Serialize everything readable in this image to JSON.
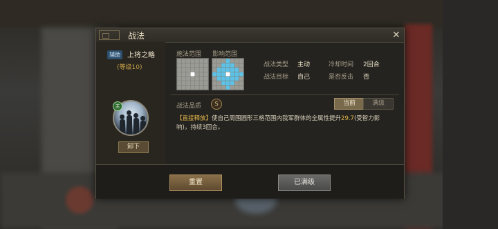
{
  "dialog": {
    "title": "战法",
    "close_icon": "close-icon"
  },
  "skill": {
    "tag": "辅助",
    "name": "上将之略",
    "level": "(等级10)",
    "unequip_label": "卸下",
    "avatar_badge": "主"
  },
  "ranges": {
    "cast_label": "施法范围",
    "effect_label": "影响范围",
    "grid_colors": {
      "cell": "#9b9b95",
      "line": "#7c7c77",
      "center": "#ffffff",
      "effect": "#5ec2e6"
    }
  },
  "info": {
    "type_label": "战法类型",
    "type_value": "主动",
    "target_label": "战法目标",
    "target_value": "自己",
    "cooldown_label": "冷却时间",
    "cooldown_value": "2回合",
    "counter_label": "是否反击",
    "counter_value": "否"
  },
  "quality": {
    "label": "战法品质",
    "value": "S"
  },
  "tabs": {
    "current": "当前",
    "max": "满级"
  },
  "description": {
    "tag": "【直接释放】",
    "text1": "使自己周围圆形三格范围内我军群体的全属性提升",
    "number": "29.7",
    "text2": "(受智力影响)，持续3回合。"
  },
  "footer": {
    "reset_label": "重置",
    "maxed_label": "已满级"
  }
}
